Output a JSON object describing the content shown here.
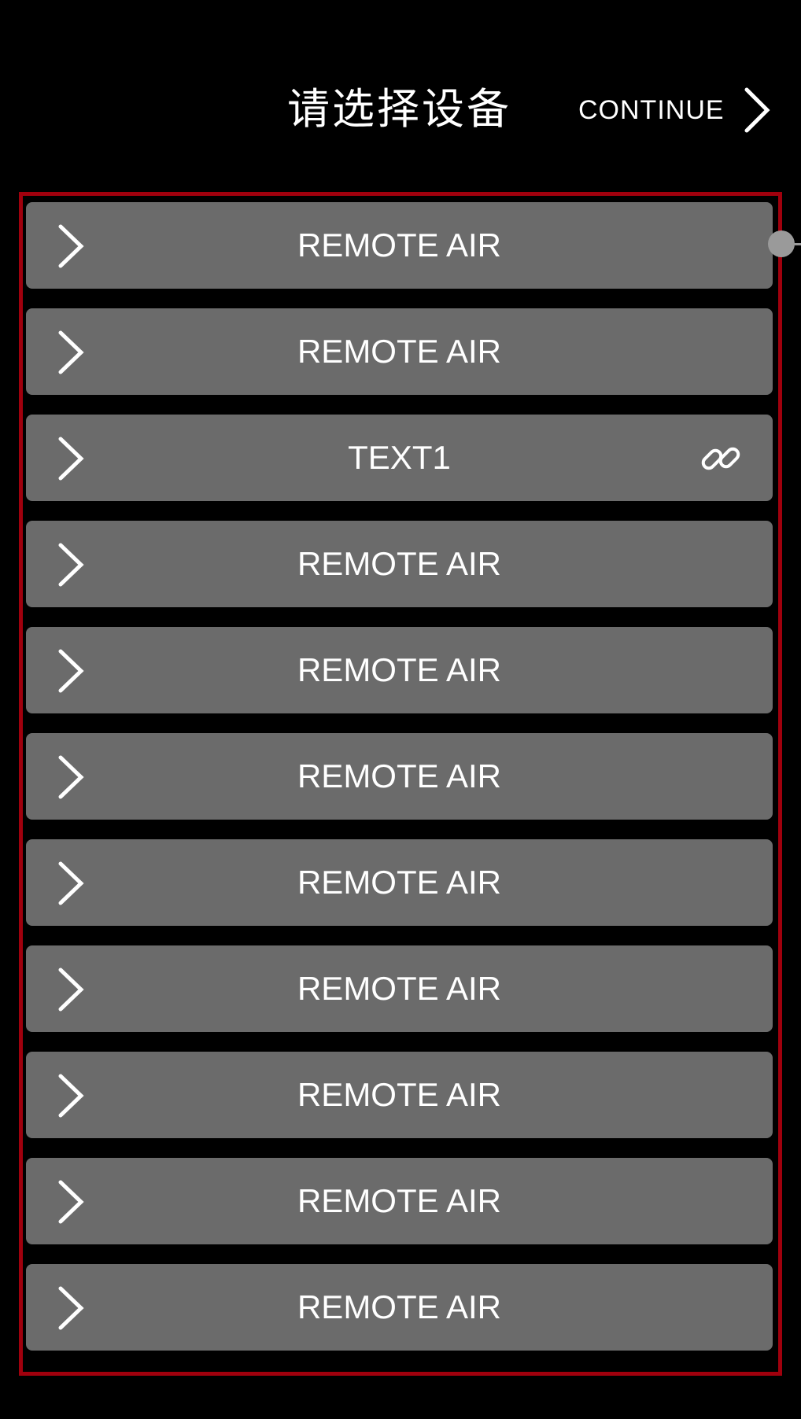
{
  "header": {
    "title": "请选择设备",
    "continue_label": "CONTINUE",
    "continue_icon": "chevron-right-icon"
  },
  "colors": {
    "background": "#000000",
    "row_background": "#6b6b6b",
    "frame_border": "#a0000d",
    "text": "#ffffff",
    "handle": "#9a9a9a"
  },
  "devices": [
    {
      "label": "REMOTE AIR",
      "linked": false
    },
    {
      "label": "REMOTE AIR",
      "linked": false
    },
    {
      "label": "TEXT1",
      "linked": true,
      "link_icon": "link-icon"
    },
    {
      "label": "REMOTE AIR",
      "linked": false
    },
    {
      "label": "REMOTE AIR",
      "linked": false
    },
    {
      "label": "REMOTE AIR",
      "linked": false
    },
    {
      "label": "REMOTE AIR",
      "linked": false
    },
    {
      "label": "REMOTE AIR",
      "linked": false
    },
    {
      "label": "REMOTE AIR",
      "linked": false
    },
    {
      "label": "REMOTE AIR",
      "linked": false
    },
    {
      "label": "REMOTE AIR",
      "linked": false
    }
  ]
}
